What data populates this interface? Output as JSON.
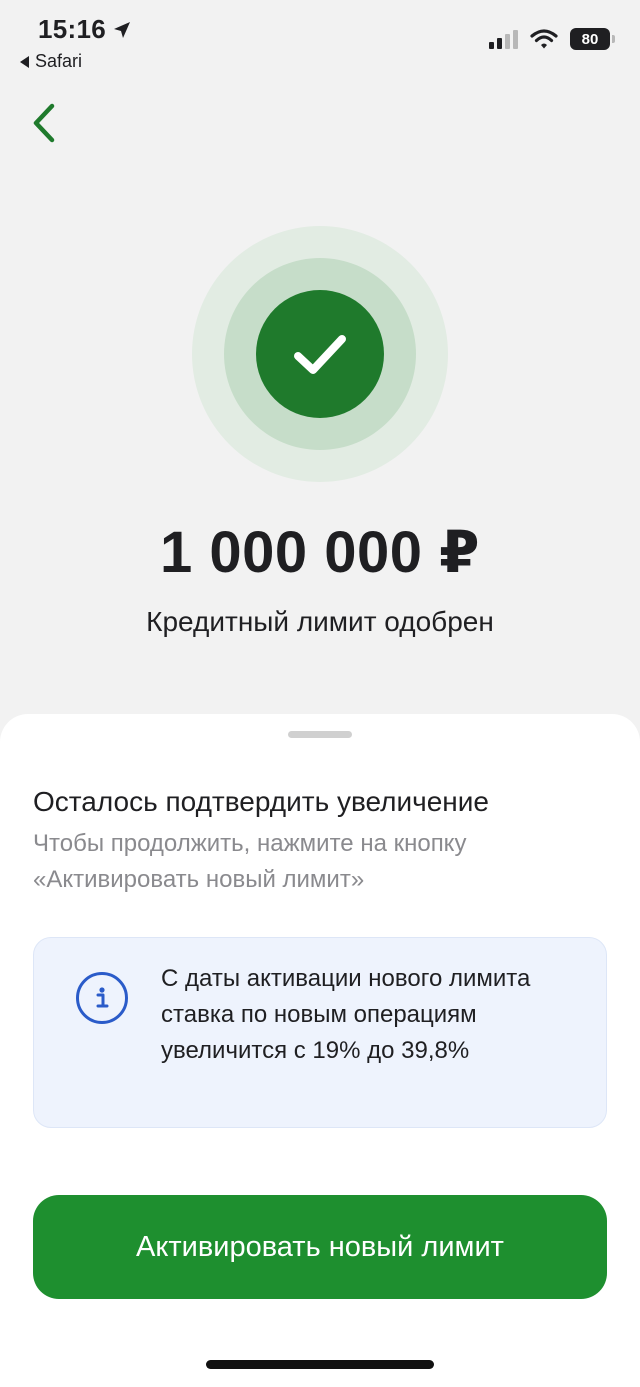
{
  "status_bar": {
    "time": "15:16",
    "back_app": "Safari",
    "battery": "80"
  },
  "success": {
    "amount": "1 000 000 ₽",
    "message": "Кредитный лимит одобрен"
  },
  "sheet": {
    "title": "Осталось подтвердить увеличение",
    "description": "Чтобы продолжить, нажмите на кнопку «Активировать новый лимит»",
    "info_text": "С даты активации нового лимита ставка по новым операциям увеличится с 19% до 39,8%",
    "button_label": "Активировать новый лимит"
  },
  "colors": {
    "brand_green": "#1e8f2f",
    "check_green": "#1f7a2c",
    "info_blue": "#2a5bc9"
  },
  "icons": {
    "nav": "chevron-left-icon",
    "status": "check-icon",
    "info": "info-icon"
  }
}
